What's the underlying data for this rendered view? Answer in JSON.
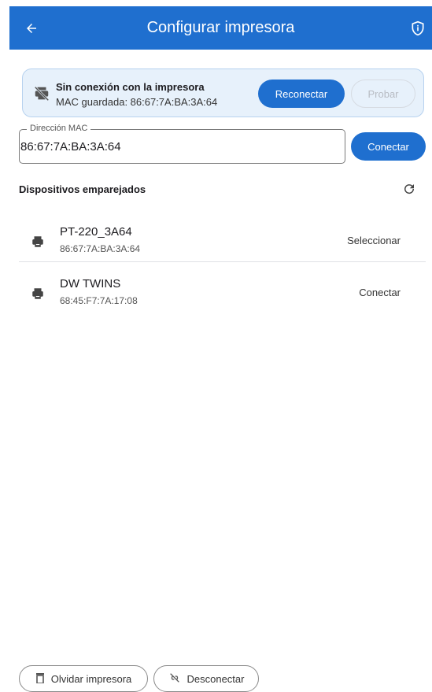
{
  "appbar": {
    "title": "Configurar impresora",
    "back_icon": "arrow-left-icon",
    "info_icon": "shield-info-icon",
    "color": "#1f6fcf"
  },
  "status": {
    "title": "Sin conexión con la impresora",
    "subtitle": "MAC guardada: 86:67:7A:BA:3A:64",
    "reconnect_label": "Reconectar",
    "test_label": "Probar",
    "icon": "printer-off-icon"
  },
  "mac_input": {
    "label": "Dirección MAC",
    "value": "86:67:7A:BA:3A:64",
    "connect_label": "Conectar"
  },
  "paired": {
    "title": "Dispositivos emparejados",
    "refresh_icon": "refresh-icon",
    "devices": [
      {
        "name": "PT-220_3A64",
        "mac": "86:67:7A:BA:3A:64",
        "action": "Seleccionar"
      },
      {
        "name": "DW TWINS",
        "mac": "68:45:F7:7A:17:08",
        "action": "Conectar"
      }
    ]
  },
  "bottom": {
    "forget_label": "Olvidar impresora",
    "disconnect_label": "Desconectar"
  }
}
